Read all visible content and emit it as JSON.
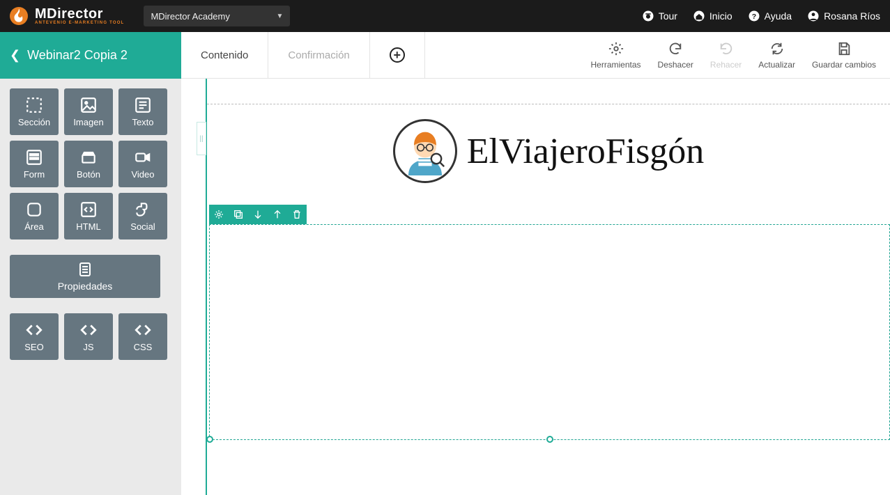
{
  "brand": {
    "name": "MDirector",
    "tagline": "ANTEVENIO E-MARKETING TOOL"
  },
  "workspace_selector": {
    "label": "MDirector Academy"
  },
  "top_nav": {
    "tour": "Tour",
    "home": "Inicio",
    "help": "Ayuda",
    "user": "Rosana Ríos"
  },
  "page_title": "Webinar2 Copia 2",
  "sidebar": {
    "tools": {
      "section": "Sección",
      "image": "Imagen",
      "text": "Texto",
      "form": "Form",
      "button": "Botón",
      "video": "Video",
      "area": "Área",
      "html": "HTML",
      "social": "Social"
    },
    "properties": "Propiedades",
    "code": {
      "seo": "SEO",
      "js": "JS",
      "css": "CSS"
    }
  },
  "tabs": {
    "content": "Contenido",
    "confirm": "Confirmación"
  },
  "editor_actions": {
    "tools": "Herramientas",
    "undo": "Deshacer",
    "redo": "Rehacer",
    "refresh": "Actualizar",
    "save": "Guardar cambios"
  },
  "canvas_content": {
    "brand_text": "ElViajeroFisgón"
  }
}
